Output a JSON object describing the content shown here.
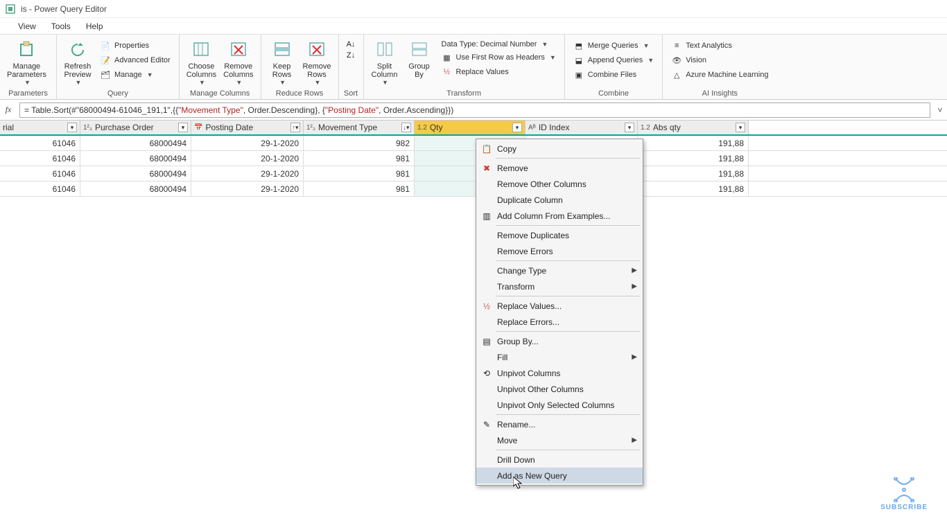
{
  "window": {
    "title": "is - Power Query Editor"
  },
  "menu": {
    "view": "View",
    "tools": "Tools",
    "help": "Help"
  },
  "ribbon": {
    "manage_parameters": "Manage\nParameters",
    "refresh_preview": "Refresh\nPreview",
    "properties": "Properties",
    "advanced_editor": "Advanced Editor",
    "manage": "Manage",
    "choose_columns": "Choose\nColumns",
    "remove_columns": "Remove\nColumns",
    "keep_rows": "Keep\nRows",
    "remove_rows": "Remove\nRows",
    "sort_asc": "A↓Z",
    "sort_desc": "Z↓A",
    "split_column": "Split\nColumn",
    "group_by": "Group\nBy",
    "data_type": "Data Type: Decimal Number",
    "first_row": "Use First Row as Headers",
    "replace_values": "Replace Values",
    "merge_queries": "Merge Queries",
    "append_queries": "Append Queries",
    "combine_files": "Combine Files",
    "text_analytics": "Text Analytics",
    "vision": "Vision",
    "azure_ml": "Azure Machine Learning",
    "groups": {
      "parameters": "Parameters",
      "query": "Query",
      "manage_columns": "Manage Columns",
      "reduce_rows": "Reduce Rows",
      "sort": "Sort",
      "transform": "Transform",
      "combine": "Combine",
      "ai_insights": "AI Insights"
    }
  },
  "formula": {
    "prefix": "= Table.Sort(#\"68000494-61046_191,1\",{{",
    "kw1": "\"Movement Type\"",
    "mid1": ", Order.Descending}, {",
    "kw2": "\"Posting Date\"",
    "suffix": ", Order.Ascending}})"
  },
  "columns": {
    "material": "rial",
    "po": "Purchase Order",
    "date": "Posting Date",
    "move": "Movement Type",
    "qty": "Qty",
    "index": "ID Index",
    "abs": "Abs qty"
  },
  "rows": [
    {
      "material": "61046",
      "po": "68000494",
      "date": "29-1-2020",
      "move": "982",
      "qty": "",
      "abs": "191,88"
    },
    {
      "material": "61046",
      "po": "68000494",
      "date": "20-1-2020",
      "move": "981",
      "qty": "",
      "abs": "191,88"
    },
    {
      "material": "61046",
      "po": "68000494",
      "date": "29-1-2020",
      "move": "981",
      "qty": "",
      "abs": "191,88"
    },
    {
      "material": "61046",
      "po": "68000494",
      "date": "29-1-2020",
      "move": "981",
      "qty": "",
      "abs": "191,88"
    }
  ],
  "context": {
    "copy": "Copy",
    "remove": "Remove",
    "remove_other": "Remove Other Columns",
    "duplicate": "Duplicate Column",
    "add_examples": "Add Column From Examples...",
    "remove_dup": "Remove Duplicates",
    "remove_err": "Remove Errors",
    "change_type": "Change Type",
    "transform": "Transform",
    "replace_values": "Replace Values...",
    "replace_errors": "Replace Errors...",
    "group_by": "Group By...",
    "fill": "Fill",
    "unpivot": "Unpivot Columns",
    "unpivot_other": "Unpivot Other Columns",
    "unpivot_sel": "Unpivot Only Selected Columns",
    "rename": "Rename...",
    "move": "Move",
    "drill": "Drill Down",
    "add_query": "Add as New Query"
  },
  "subscribe": "SUBSCRIBE"
}
